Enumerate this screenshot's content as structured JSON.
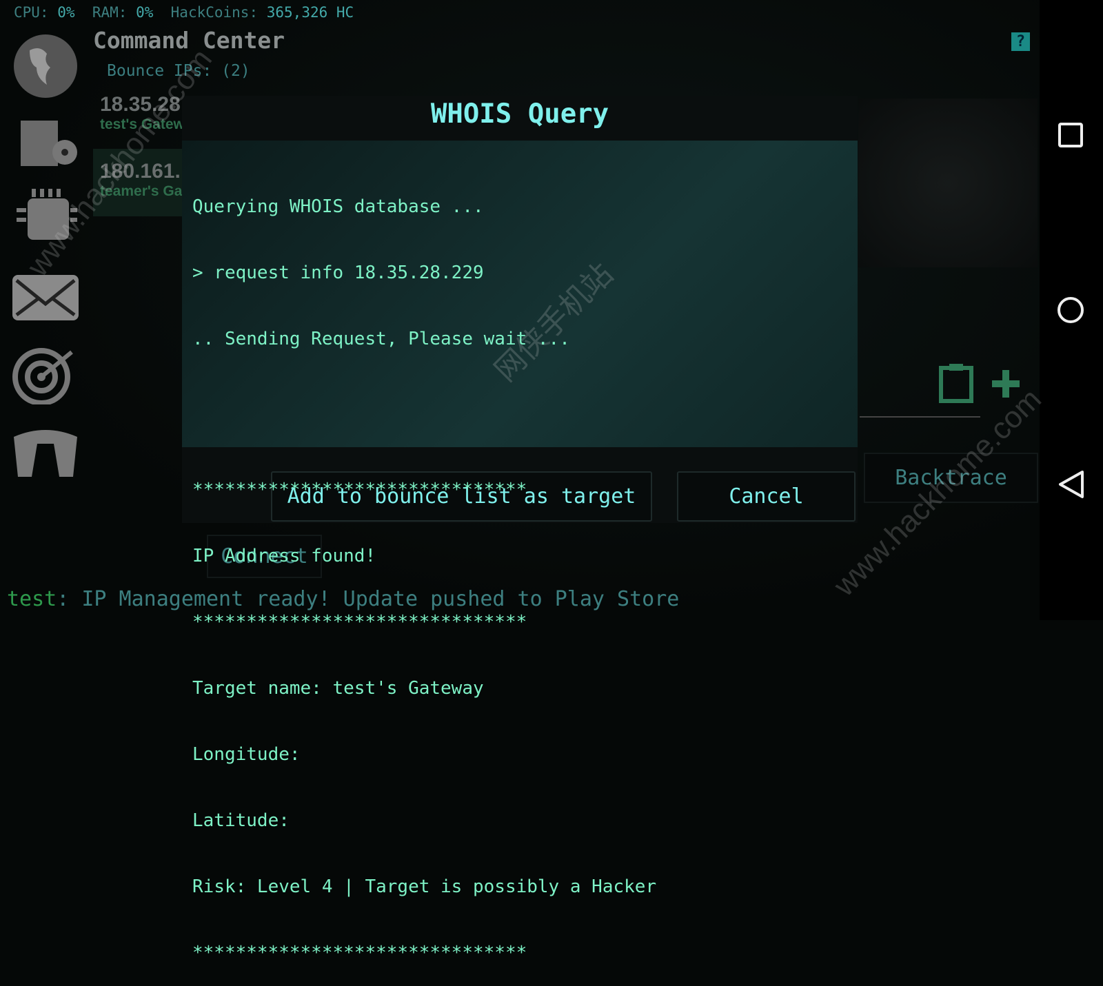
{
  "status_bar": {
    "cpu_label": "CPU:",
    "cpu": "0%",
    "ram_label": "RAM:",
    "ram": "0%",
    "coins_label": "HackCoins:",
    "coins": "365,326 HC"
  },
  "header": {
    "title": "Command Center",
    "bounce_ips": "Bounce IPs: (2)"
  },
  "bounce_list": [
    {
      "ip": "18.35.28",
      "name": "test's Gatew"
    },
    {
      "ip": "180.161.",
      "name": "teamer's Ga"
    }
  ],
  "sidebar": [
    "globe-icon",
    "software-box-icon",
    "cpu-chip-icon",
    "mail-icon",
    "target-icon",
    "bridge-icon"
  ],
  "dialog": {
    "title": "WHOIS Query",
    "lines": [
      "Querying WHOIS database ...",
      "> request info 18.35.28.229",
      ".. Sending Request, Please wait ...",
      "",
      "*******************************",
      "IP Address found!",
      "*******************************",
      "Target name: test's Gateway",
      "Longitude:",
      "Latitude:",
      "Risk: Level 4 | Target is possibly a Hacker",
      "*******************************"
    ],
    "add_button": "Add to bounce list as target",
    "cancel_button": "Cancel"
  },
  "background": {
    "connect": "Connect",
    "backtrace": "Backtrace",
    "help": "?"
  },
  "ticker": {
    "user": "test",
    "message": ": IP Management ready! Update pushed to Play Store"
  },
  "watermark": [
    "www.hackhome.com",
    "网侠手机站",
    "www.hackhome.com"
  ],
  "colors": {
    "accent": "#7ff0ec",
    "console_text": "#7ef2c6",
    "muted": "#3d7f80",
    "green": "#2e9a4c"
  }
}
